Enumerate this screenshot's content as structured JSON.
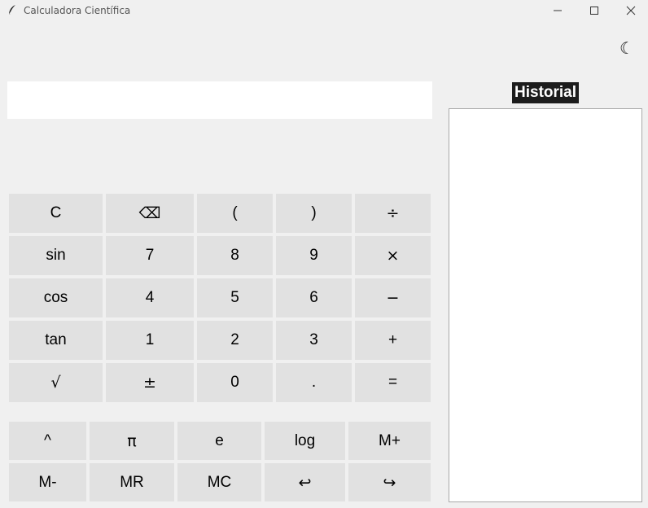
{
  "window": {
    "title": "Calculadora Científica",
    "minimize": "—",
    "maximize": "☐",
    "close": "✕"
  },
  "theme_toggle": "☾",
  "display": {
    "value": ""
  },
  "history": {
    "title": "Historial",
    "entries": []
  },
  "keypad": {
    "row1": [
      "C",
      "⌫",
      "(",
      ")",
      "÷"
    ],
    "row2": [
      "sin",
      "7",
      "8",
      "9",
      "×"
    ],
    "row3": [
      "cos",
      "4",
      "5",
      "6",
      "−"
    ],
    "row4": [
      "tan",
      "1",
      "2",
      "3",
      "+"
    ],
    "row5": [
      "√",
      "±",
      "0",
      ".",
      "="
    ]
  },
  "extra": {
    "row1": [
      "^",
      "π",
      "e",
      "log",
      "M+"
    ],
    "row2": [
      "M-",
      "MR",
      "MC",
      "↩",
      "↪"
    ]
  },
  "colors": {
    "background": "#f0f0f0",
    "button": "#e1e1e1",
    "history_title_bg": "#1c1c1c",
    "history_title_fg": "#ffffff"
  }
}
